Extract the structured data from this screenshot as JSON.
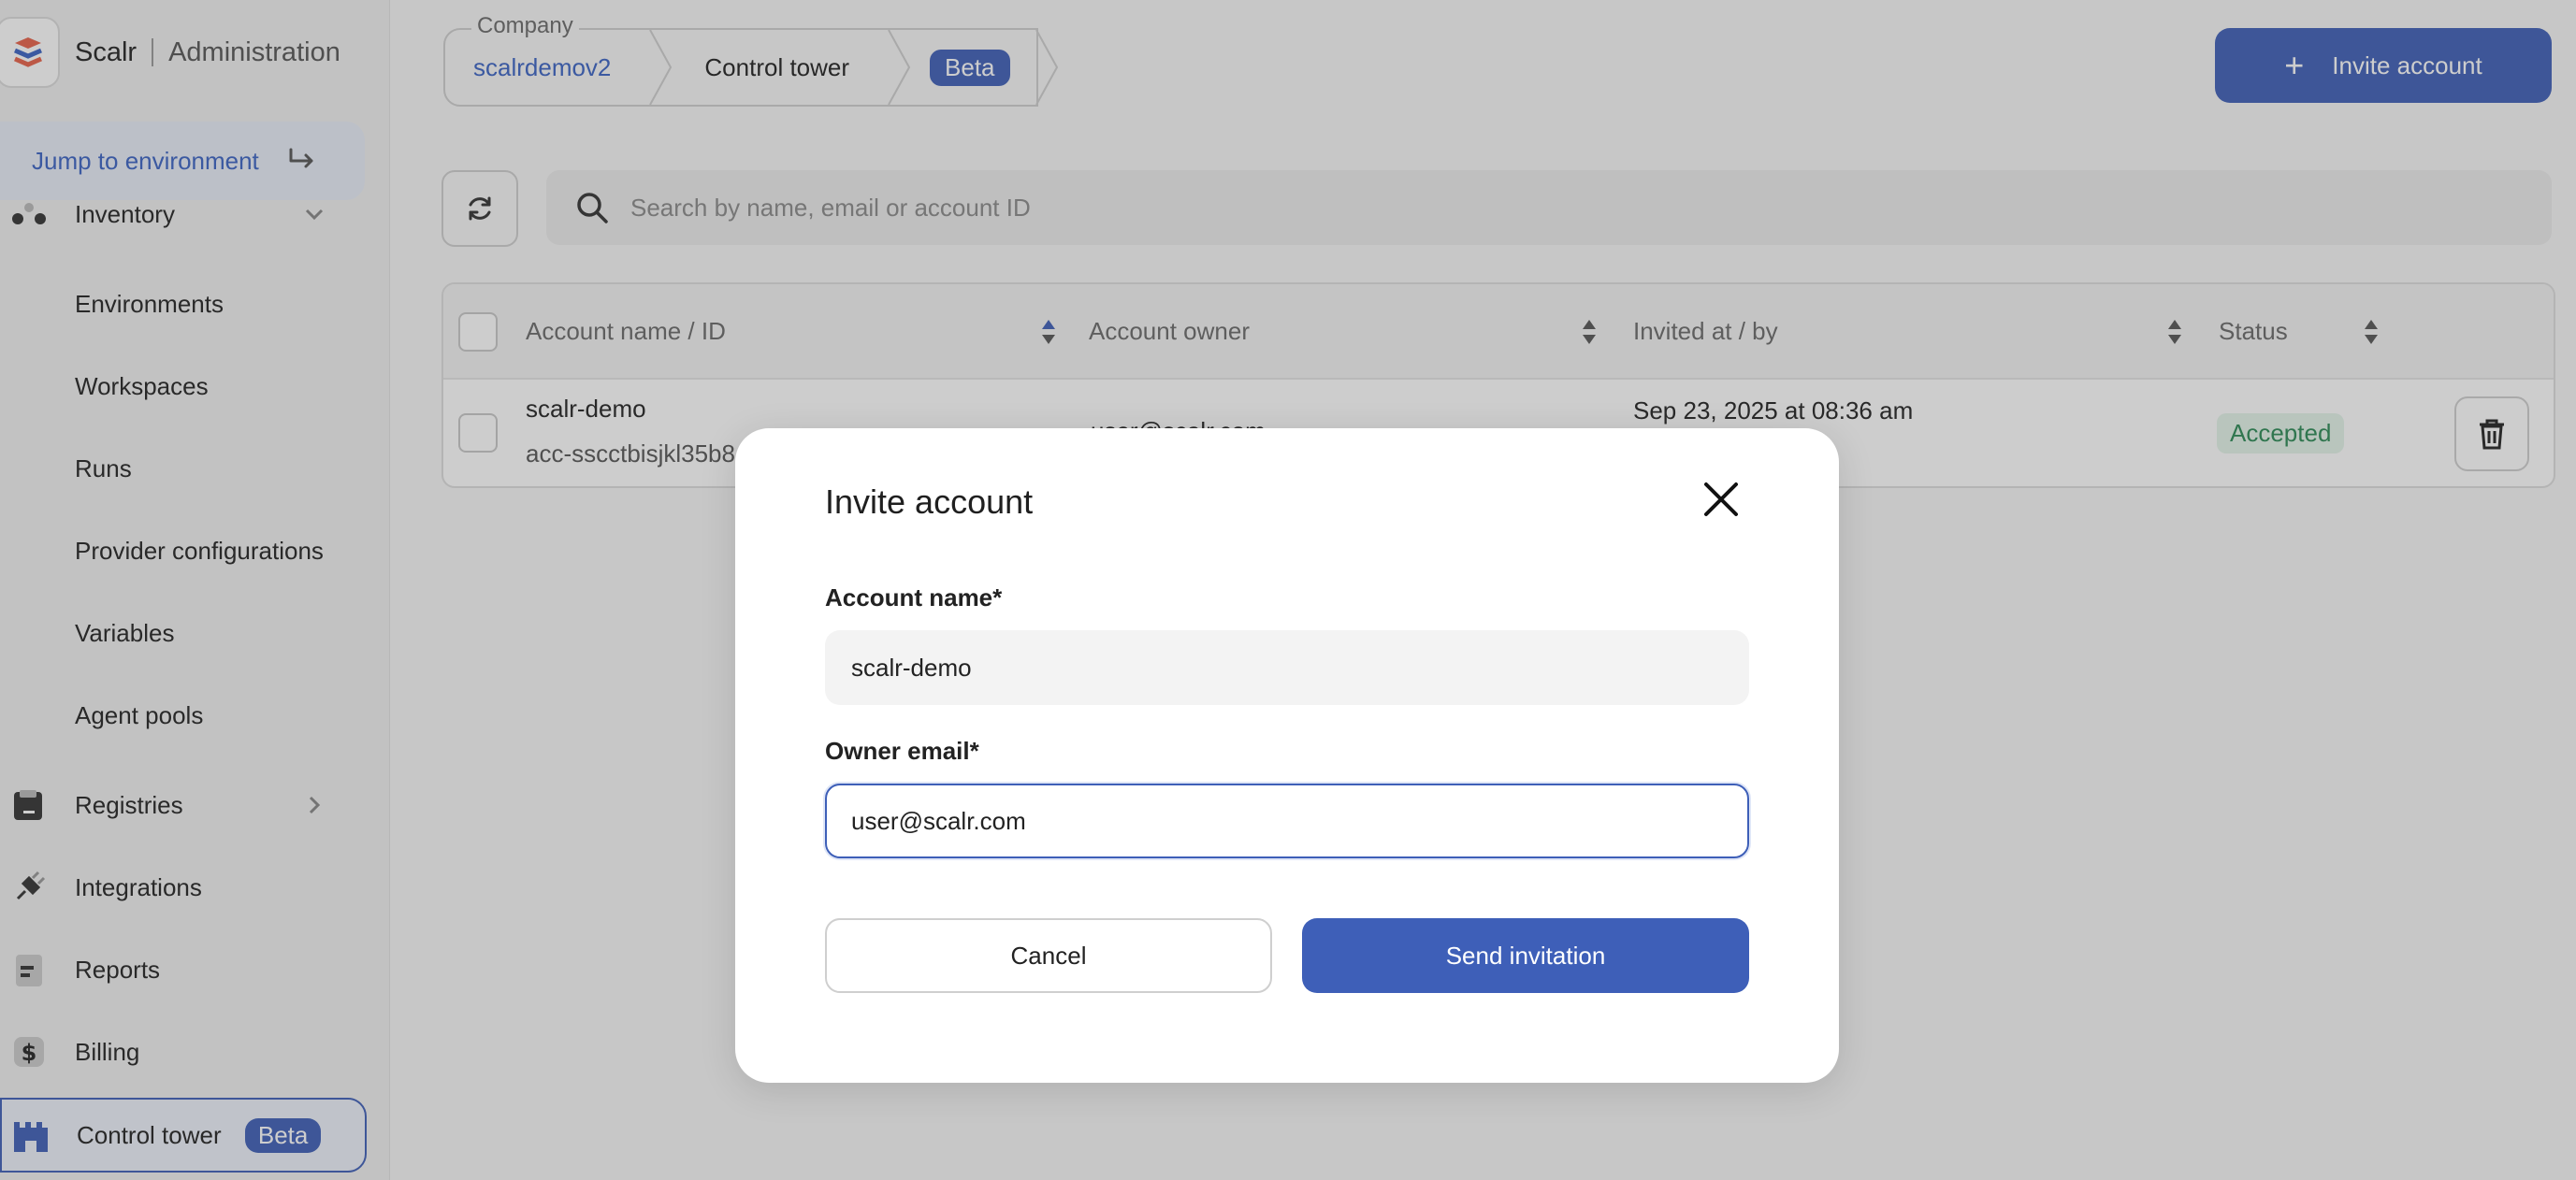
{
  "brand": {
    "name": "Scalr",
    "section": "Administration"
  },
  "sidebar": {
    "jump_label": "Jump to environment",
    "items": [
      {
        "label": "Inventory",
        "icon": "inventory-icon"
      },
      {
        "label": "Environments"
      },
      {
        "label": "Workspaces"
      },
      {
        "label": "Runs"
      },
      {
        "label": "Provider configurations"
      },
      {
        "label": "Variables"
      },
      {
        "label": "Agent pools"
      },
      {
        "label": "Registries",
        "icon": "registry-icon"
      },
      {
        "label": "Integrations",
        "icon": "plug-icon"
      },
      {
        "label": "Reports",
        "icon": "report-icon"
      },
      {
        "label": "Billing",
        "icon": "dollar-icon"
      },
      {
        "label": "Control tower",
        "icon": "castle-icon",
        "badge": "Beta"
      }
    ]
  },
  "breadcrumb": {
    "company_label": "Company",
    "company": "scalrdemov2",
    "page": "Control tower",
    "badge": "Beta"
  },
  "toolbar": {
    "invite_label": "Invite account",
    "search_placeholder": "Search by name, email or account ID"
  },
  "table": {
    "headers": [
      "Account name / ID",
      "Account owner",
      "Invited at / by",
      "Status"
    ],
    "rows": [
      {
        "name": "scalr-demo",
        "id": "acc-sscctbisjkl35b8",
        "owner": "user@scalr.com",
        "invited_at": "Sep 23, 2025 at 08:36 am",
        "status": "Accepted"
      }
    ]
  },
  "modal": {
    "title": "Invite account",
    "account_name_label": "Account name*",
    "account_name_value": "scalr-demo",
    "owner_email_label": "Owner email*",
    "owner_email_value": "user@scalr.com",
    "cancel_label": "Cancel",
    "send_label": "Send invitation"
  },
  "colors": {
    "accent": "#3e5fb8",
    "status_accepted_bg": "#e4f4ea",
    "status_accepted_text": "#2c8a55"
  }
}
